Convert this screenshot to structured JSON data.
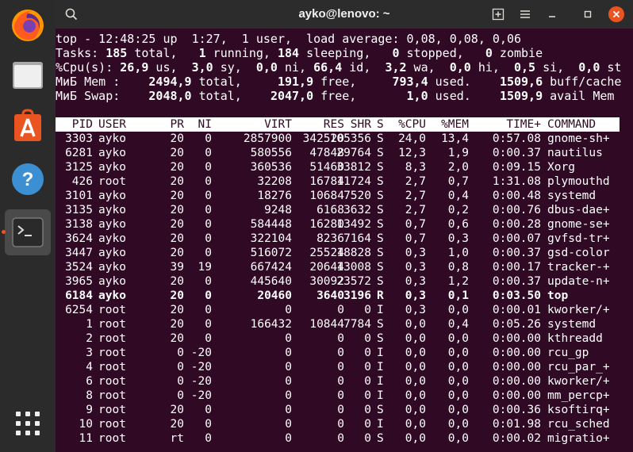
{
  "window": {
    "title": "ayko@lenovo: ~"
  },
  "dock": {
    "apps": [
      {
        "name": "firefox"
      },
      {
        "name": "files"
      },
      {
        "name": "ubuntu-software"
      },
      {
        "name": "help"
      },
      {
        "name": "terminal",
        "active": true
      },
      {
        "name": "show-applications"
      }
    ]
  },
  "summary": {
    "line1": "top - 12:48:25 up  1:27,  1 user,  load average: 0,08, 0,08, 0,06",
    "tasks": {
      "label": "Tasks:",
      "total": "185",
      "total_l": " total,",
      "running": "1",
      "running_l": " running,",
      "sleeping": "184",
      "sleeping_l": " sleeping,",
      "stopped": "0",
      "stopped_l": " stopped,",
      "zombie": "0",
      "zombie_l": " zombie"
    },
    "cpu": {
      "label": "%Cpu(s):",
      "us": "26,9",
      "us_l": " us,",
      "sy": "3,0",
      "sy_l": " sy,",
      "ni": "0,0",
      "ni_l": " ni,",
      "id": "66,4",
      "id_l": " id,",
      "wa": "3,2",
      "wa_l": " wa,",
      "hi": "0,0",
      "hi_l": " hi,",
      "si": "0,5",
      "si_l": " si,",
      "st": "0,0",
      "st_l": " st"
    },
    "mem": {
      "label": "МиБ Mem :",
      "total": "2494,9",
      "total_l": " total,",
      "free": "191,9",
      "free_l": " free,",
      "used": "793,4",
      "used_l": " used.",
      "buff": "1509,6",
      "buff_l": " buff/cache"
    },
    "swap": {
      "label": "МиБ Swap:",
      "total": "2048,0",
      "total_l": " total,",
      "free": "2047,0",
      "free_l": " free,",
      "used": "1,0",
      "used_l": " used.",
      "avail": "1509,9",
      "avail_l": " avail Mem"
    }
  },
  "table": {
    "columns": [
      "PID",
      "USER",
      "PR",
      "NI",
      "VIRT",
      "RES",
      "SHR",
      "S",
      "%CPU",
      "%MEM",
      "TIME+",
      "COMMAND"
    ],
    "rows": [
      [
        "3303",
        "ayko",
        "20",
        "0",
        "2857900",
        "342520",
        "105356",
        "S",
        "24,0",
        "13,4",
        "0:57.08",
        "gnome-sh+"
      ],
      [
        "6281",
        "ayko",
        "20",
        "0",
        "580556",
        "47848",
        "29764",
        "S",
        "12,3",
        "1,9",
        "0:00.37",
        "nautilus"
      ],
      [
        "3125",
        "ayko",
        "20",
        "0",
        "360536",
        "51460",
        "33812",
        "S",
        "8,3",
        "2,0",
        "0:09.15",
        "Xorg"
      ],
      [
        "426",
        "root",
        "20",
        "0",
        "32208",
        "16784",
        "11724",
        "S",
        "2,7",
        "0,7",
        "1:31.08",
        "plymouthd"
      ],
      [
        "3101",
        "ayko",
        "20",
        "0",
        "18276",
        "10684",
        "7520",
        "S",
        "2,7",
        "0,4",
        "0:00.48",
        "systemd"
      ],
      [
        "3135",
        "ayko",
        "20",
        "0",
        "9248",
        "6168",
        "3632",
        "S",
        "2,7",
        "0,2",
        "0:00.76",
        "dbus-dae+"
      ],
      [
        "3138",
        "ayko",
        "20",
        "0",
        "584448",
        "16280",
        "13492",
        "S",
        "0,7",
        "0,6",
        "0:00.28",
        "gnome-se+"
      ],
      [
        "3624",
        "ayko",
        "20",
        "0",
        "322104",
        "8236",
        "7164",
        "S",
        "0,7",
        "0,3",
        "0:00.07",
        "gvfsd-tr+"
      ],
      [
        "3447",
        "ayko",
        "20",
        "0",
        "516072",
        "25524",
        "18828",
        "S",
        "0,3",
        "1,0",
        "0:00.37",
        "gsd-color"
      ],
      [
        "3524",
        "ayko",
        "39",
        "19",
        "667424",
        "20644",
        "13008",
        "S",
        "0,3",
        "0,8",
        "0:00.17",
        "tracker-+"
      ],
      [
        "3965",
        "ayko",
        "20",
        "0",
        "445640",
        "30092",
        "23572",
        "S",
        "0,3",
        "1,2",
        "0:00.37",
        "update-n+"
      ],
      [
        "6184",
        "ayko",
        "20",
        "0",
        "20460",
        "3640",
        "3196",
        "R",
        "0,3",
        "0,1",
        "0:03.50",
        "top"
      ],
      [
        "6254",
        "root",
        "20",
        "0",
        "0",
        "0",
        "0",
        "I",
        "0,3",
        "0,0",
        "0:00.01",
        "kworker/+"
      ],
      [
        "1",
        "root",
        "20",
        "0",
        "166432",
        "10844",
        "7784",
        "S",
        "0,0",
        "0,4",
        "0:05.26",
        "systemd"
      ],
      [
        "2",
        "root",
        "20",
        "0",
        "0",
        "0",
        "0",
        "S",
        "0,0",
        "0,0",
        "0:00.00",
        "kthreadd"
      ],
      [
        "3",
        "root",
        "0",
        "-20",
        "0",
        "0",
        "0",
        "I",
        "0,0",
        "0,0",
        "0:00.00",
        "rcu_gp"
      ],
      [
        "4",
        "root",
        "0",
        "-20",
        "0",
        "0",
        "0",
        "I",
        "0,0",
        "0,0",
        "0:00.00",
        "rcu_par_+"
      ],
      [
        "6",
        "root",
        "0",
        "-20",
        "0",
        "0",
        "0",
        "I",
        "0,0",
        "0,0",
        "0:00.00",
        "kworker/+"
      ],
      [
        "8",
        "root",
        "0",
        "-20",
        "0",
        "0",
        "0",
        "I",
        "0,0",
        "0,0",
        "0:00.00",
        "mm_percp+"
      ],
      [
        "9",
        "root",
        "20",
        "0",
        "0",
        "0",
        "0",
        "S",
        "0,0",
        "0,0",
        "0:00.36",
        "ksoftirq+"
      ],
      [
        "10",
        "root",
        "20",
        "0",
        "0",
        "0",
        "0",
        "I",
        "0,0",
        "0,0",
        "0:01.98",
        "rcu_sched"
      ],
      [
        "11",
        "root",
        "rt",
        "0",
        "0",
        "0",
        "0",
        "S",
        "0,0",
        "0,0",
        "0:00.02",
        "migratio+"
      ]
    ],
    "bold_row_pid": "6184"
  },
  "colors": {
    "terminal_bg": "#300a24",
    "titlebar_bg": "#2c2c2c",
    "dock_bg": "#2b2b2b",
    "accent": "#e95420"
  }
}
